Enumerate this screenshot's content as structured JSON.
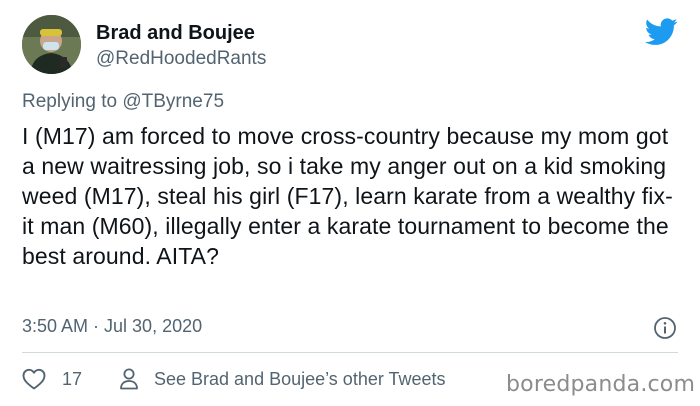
{
  "author": {
    "display_name": "Brad and Boujee",
    "handle": "@RedHoodedRants"
  },
  "reply": {
    "prefix": "Replying to ",
    "mention": "@TByrne75"
  },
  "tweet": {
    "text": "I (M17) am forced to move cross-country because my mom got a new waitressing job, so i take my anger out on a kid smoking weed (M17), steal his girl (F17), learn karate from a wealthy fix-it man (M60), illegally enter a karate tournament to become the best around. AITA?",
    "timestamp": "3:50 AM · Jul 30, 2020"
  },
  "actions": {
    "like_count": "17",
    "other_tweets_label": "See Brad and Boujee’s other Tweets"
  },
  "watermark": "boredpanda.com",
  "icons": {
    "logo": "twitter-bird-icon",
    "info": "info-icon",
    "like": "heart-icon",
    "profile": "person-icon"
  },
  "colors": {
    "twitter_blue": "#1d9bf0",
    "secondary_text": "#536471",
    "primary_text": "#0f1419"
  }
}
